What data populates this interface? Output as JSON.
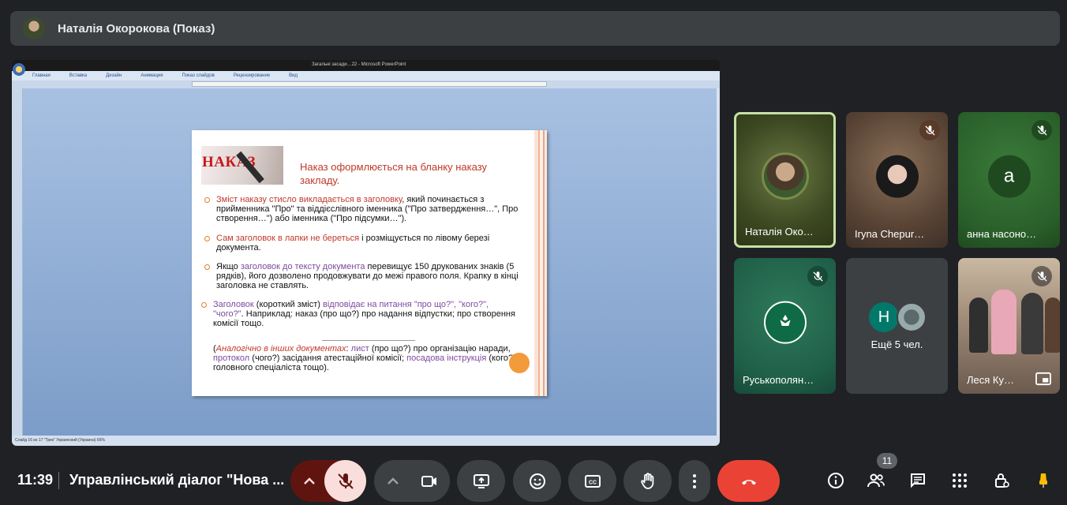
{
  "header": {
    "presenter_title": "Наталія Окорокова (Показ)"
  },
  "presentation": {
    "window_title": "Загальні засади…22 - Microsoft PowerPoint",
    "ribbon_tabs": [
      "Главная",
      "Вставка",
      "Дизайн",
      "Анимация",
      "Показ слайдов",
      "Рецензирование",
      "Вид"
    ],
    "status": "Слайд 16 из 17   \"Трек\"   Украинский (Украина)        66%",
    "slide": {
      "logo_text": "НАКАЗ",
      "heading": "Наказ оформлюється на бланку наказу закладу.",
      "bullet1_red": "Зміст наказу стисло викладається в заголовку",
      "bullet1_rest": ", який починається з прийменника \"Про\" та віддієслівного іменника (\"Про затвердження…\", Про створення…\")  або іменника (\"Про підсумки…\").",
      "bullet2_red": "Сам заголовок в лапки не береться",
      "bullet2_rest": " і розміщується по лівому березі документа.",
      "bullet3_pre": "Якщо ",
      "bullet3_purple": "заголовок до тексту документа",
      "bullet3_rest": " перевищує 150 друкованих знаків (5 рядків), його дозволено продовжувати до межі правого поля. Крапку в кінці заголовка не ставлять.",
      "bullet4_p1": "Заголовок",
      "bullet4_t1": " (короткий зміст) ",
      "bullet4_p2": "відповідає на питання \"про що?\", \"кого?\", \"чого?\"",
      "bullet4_t2": ". Наприклад: наказ (про що?) про надання відпустки; про створення комісії тощо.",
      "note_open": "(",
      "note_red": "Аналогічно в інших документах",
      "note_colon": ": ",
      "note_p1": "лист",
      "note_t1": " (про що?) про організацію наради, ",
      "note_p2": "протокол",
      "note_t2": " (чого?) засідання атестаційної комісії; ",
      "note_p3": "посадова інструкція",
      "note_t3": " (кого?) головного спеціаліста тощо)."
    }
  },
  "participants": [
    {
      "name": "Наталія Око…",
      "muted": false,
      "active_speaker": true,
      "bg": "#4a5a2a"
    },
    {
      "name": "Iryna Chepur…",
      "muted": true,
      "bg": "#6a5040"
    },
    {
      "name": "анна насоно…",
      "muted": true,
      "initial": "a",
      "bg": "#2f6a2f",
      "avatar_color": "#1f4a1f"
    },
    {
      "name": "Руськополян…",
      "muted": true,
      "bg": "#1f5f48"
    },
    {
      "more_label": "Ещё 5 чел.",
      "initial": "Н",
      "avatar_color": "#00796b",
      "bg": "#3c4043"
    },
    {
      "name": "Леся Ку…",
      "muted": true,
      "bg": "#7a6a5a"
    }
  ],
  "footer": {
    "time": "11:39",
    "meeting_title": "Управлінський діалог \"Нова ...",
    "participant_count": "11",
    "colors": {
      "mic_off_bg": "#f9dedc",
      "mic_expand_bg": "#601410",
      "end_call": "#ea4335",
      "accent_yellow": "#fbbc04"
    }
  }
}
